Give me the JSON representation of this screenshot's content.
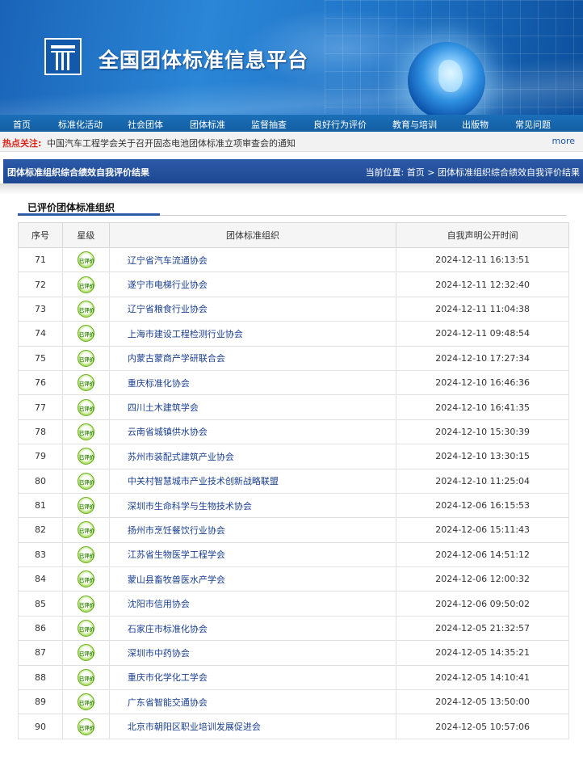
{
  "header": {
    "site_title": "全国团体标准信息平台"
  },
  "nav": {
    "items": [
      {
        "label": "首页"
      },
      {
        "label": "标准化活动"
      },
      {
        "label": "社会团体"
      },
      {
        "label": "团体标准"
      },
      {
        "label": "监督抽查"
      },
      {
        "label": "良好行为评价"
      },
      {
        "label": "教育与培训"
      },
      {
        "label": "出版物"
      },
      {
        "label": "常见问题"
      }
    ]
  },
  "hotbar": {
    "label": "热点关注:",
    "text": "中国汽车工程学会关于召开固态电池团体标准立项审查会的通知",
    "more": "more"
  },
  "titlebar": {
    "title": "团体标准组织综合绩效自我评价结果",
    "location_label": "当前位置:",
    "home": "首页",
    "separator": ">",
    "current": "团体标准组织综合绩效自我评价结果"
  },
  "section": {
    "title": "已评价团体标准组织"
  },
  "table": {
    "headers": {
      "index": "序号",
      "star": "星级",
      "org": "团体标准组织",
      "date": "自我声明公开时间"
    },
    "badge_label": "已评价",
    "rows": [
      {
        "index": "71",
        "org": "辽宁省汽车流通协会",
        "date": "2024-12-11 16:13:51"
      },
      {
        "index": "72",
        "org": "遂宁市电梯行业协会",
        "date": "2024-12-11 12:32:40"
      },
      {
        "index": "73",
        "org": "辽宁省粮食行业协会",
        "date": "2024-12-11 11:04:38"
      },
      {
        "index": "74",
        "org": "上海市建设工程检测行业协会",
        "date": "2024-12-11 09:48:54"
      },
      {
        "index": "75",
        "org": "内蒙古蒙商产学研联合会",
        "date": "2024-12-10 17:27:34"
      },
      {
        "index": "76",
        "org": "重庆标准化协会",
        "date": "2024-12-10 16:46:36"
      },
      {
        "index": "77",
        "org": "四川土木建筑学会",
        "date": "2024-12-10 16:41:35"
      },
      {
        "index": "78",
        "org": "云南省城镇供水协会",
        "date": "2024-12-10 15:30:39"
      },
      {
        "index": "79",
        "org": "苏州市装配式建筑产业协会",
        "date": "2024-12-10 13:30:15"
      },
      {
        "index": "80",
        "org": "中关村智慧城市产业技术创新战略联盟",
        "date": "2024-12-10 11:25:04"
      },
      {
        "index": "81",
        "org": "深圳市生命科学与生物技术协会",
        "date": "2024-12-06 16:15:53"
      },
      {
        "index": "82",
        "org": "扬州市烹饪餐饮行业协会",
        "date": "2024-12-06 15:11:43"
      },
      {
        "index": "83",
        "org": "江苏省生物医学工程学会",
        "date": "2024-12-06 14:51:12"
      },
      {
        "index": "84",
        "org": "蒙山县畜牧兽医水产学会",
        "date": "2024-12-06 12:00:32"
      },
      {
        "index": "85",
        "org": "沈阳市信用协会",
        "date": "2024-12-06 09:50:02"
      },
      {
        "index": "86",
        "org": "石家庄市标准化协会",
        "date": "2024-12-05 21:32:57"
      },
      {
        "index": "87",
        "org": "深圳市中药协会",
        "date": "2024-12-05 14:35:21"
      },
      {
        "index": "88",
        "org": "重庆市化学化工学会",
        "date": "2024-12-05 14:10:41"
      },
      {
        "index": "89",
        "org": "广东省智能交通协会",
        "date": "2024-12-05 13:50:00"
      },
      {
        "index": "90",
        "org": "北京市朝阳区职业培训发展促进会",
        "date": "2024-12-05 10:57:06"
      }
    ]
  }
}
